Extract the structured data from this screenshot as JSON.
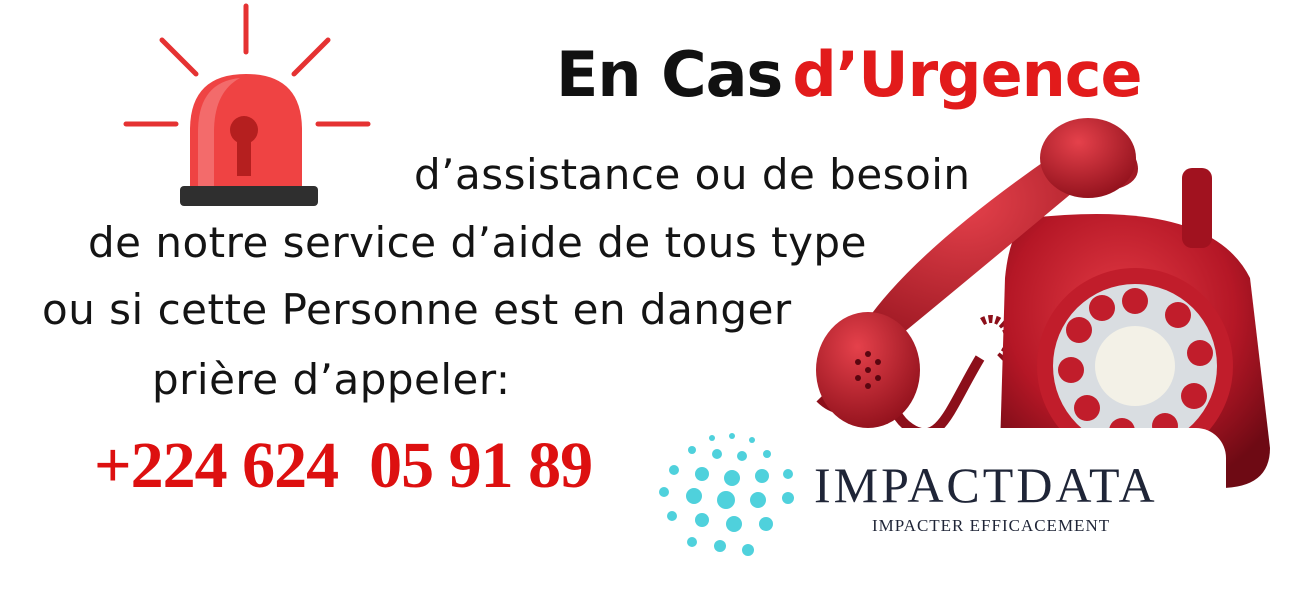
{
  "title": {
    "part1": "En Cas",
    "part2": "d’Urgence"
  },
  "lines": [
    "d’assistance ou de besoin",
    "de notre service d’aide de tous type",
    "ou si cette Personne est en danger",
    "prière d’appeler:"
  ],
  "phone": "+224 624  05 91 89",
  "logo": {
    "name": "IMPACTDATA",
    "tagline": "IMPACTER EFFICACEMENT"
  },
  "colors": {
    "accent": "#e21b1b",
    "phone_red": "#c0141c",
    "text": "#141414",
    "logo_dots": "#4fd1dc",
    "logo_text": "#1f2537"
  },
  "icons": [
    "siren-icon",
    "rotary-phone-icon",
    "impactdata-logo-dots"
  ]
}
